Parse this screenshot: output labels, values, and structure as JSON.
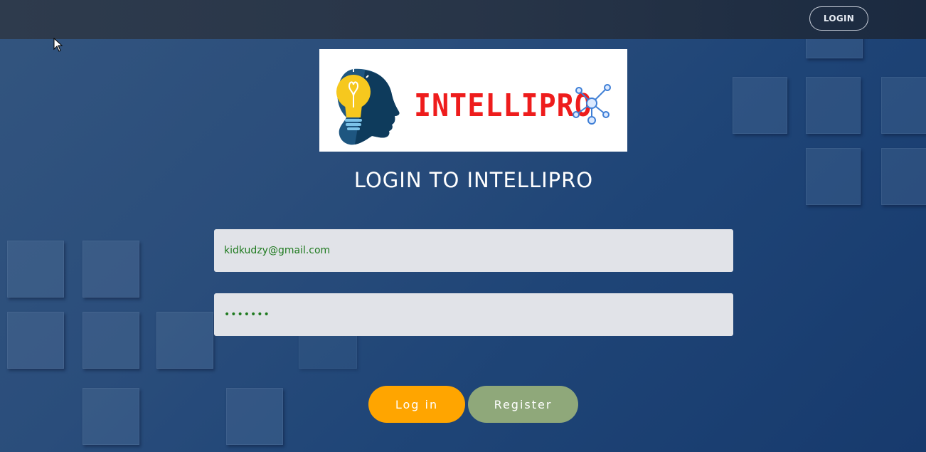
{
  "nav": {
    "login_label": "LOGIN"
  },
  "logo": {
    "brand_text": "INTELLIPRO",
    "brand_color": "#ee1c1c",
    "icons": [
      "head-lightbulb-icon",
      "network-nodes-icon"
    ]
  },
  "page": {
    "title": "LOGIN TO INTELLIPRO"
  },
  "form": {
    "email_value": "kidkudzy@gmail.com",
    "password_value": "•••••••",
    "login_button": "Log in",
    "register_button": "Register"
  },
  "colors": {
    "login_button": "#ffa500",
    "register_button": "#8fa87a",
    "field_text": "#1f7a1f",
    "background": "#1f4577"
  }
}
